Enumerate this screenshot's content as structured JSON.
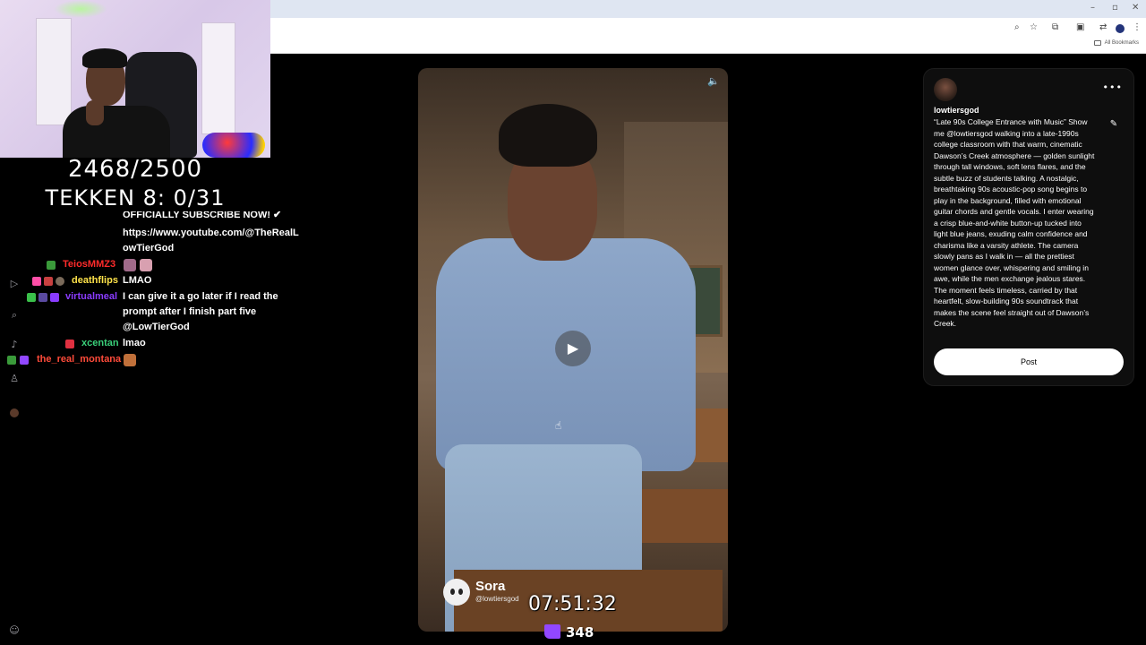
{
  "overlay": {
    "counter_primary": "2468/2500",
    "counter_tekken": "TEKKEN 8: 0/31",
    "timer": "07:51:32",
    "viewer_count": "348"
  },
  "browser": {
    "bookmarks_label": "All Bookmarks"
  },
  "chat": {
    "messages": [
      {
        "user": "",
        "text": "https://www.youtube.com/@TheRealL"
      },
      {
        "user": "",
        "text": "owTierGod"
      },
      {
        "user": "TeiosMMZ3",
        "text": ""
      },
      {
        "user": "deathflips",
        "text": "LMAO"
      },
      {
        "user": "virtualmeal",
        "text": "I can give it a go later if I read the"
      },
      {
        "user": "",
        "text": "prompt after I finish part five"
      },
      {
        "user": "",
        "text": "@LowTierGod"
      },
      {
        "user": "xcentan",
        "text": "lmao"
      },
      {
        "user": "the_real_montana",
        "text": ""
      }
    ],
    "name_colors": {
      "TeiosMMZ3": "#ff2b2b",
      "deathflips": "#ffe34a",
      "virtualmeal": "#8a3cff",
      "xcentan": "#3ad07a",
      "the_real_montana": "#ff4b3a"
    }
  },
  "video": {
    "brand": "Sora",
    "watermark_handle": "@lowtiersgod"
  },
  "post_panel": {
    "username": "lowtiersgod",
    "prompt": "“Late 90s College Entrance with Music” Show me @lowtiersgod walking into a late-1990s college classroom with that warm, cinematic Dawson’s Creek atmosphere — golden sunlight through tall windows, soft lens flares, and the subtle buzz of students talking. A nostalgic, breathtaking 90s acoustic-pop song begins to play in the background, filled with emotional guitar chords and gentle vocals. I enter wearing a crisp blue-and-white button-up tucked into light blue jeans, exuding calm confidence and charisma like a varsity athlete. The camera slowly pans as I walk in — all the prettiest women glance over, whispering and smiling in awe, while the men exchange jealous stares. The moment feels timeless, carried by that heartfelt, slow-building 90s soundtrack that makes the scene feel straight out of Dawson’s Creek.",
    "post_label": "Post"
  }
}
